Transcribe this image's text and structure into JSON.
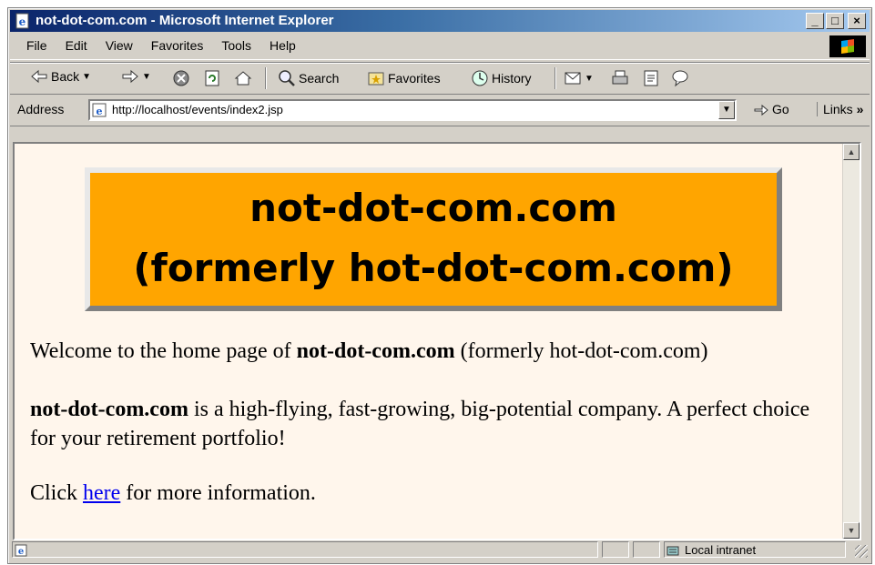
{
  "window": {
    "title": "not-dot-com.com - Microsoft Internet Explorer",
    "controls": {
      "minimize": "_",
      "maximize": "□",
      "close": "×"
    }
  },
  "menu": {
    "items": [
      "File",
      "Edit",
      "View",
      "Favorites",
      "Tools",
      "Help"
    ]
  },
  "toolbar": {
    "back": "Back",
    "search": "Search",
    "favorites": "Favorites",
    "history": "History"
  },
  "address": {
    "label": "Address",
    "url": "http://localhost/events/index2.jsp",
    "go": "Go",
    "links": "Links"
  },
  "page": {
    "banner_line1": "not-dot-com.com",
    "banner_line2": "(formerly hot-dot-com.com)",
    "p1_pre": "Welcome to the home page of ",
    "p1_bold": "not-dot-com.com",
    "p1_post": " (formerly hot-dot-com.com)",
    "p2_bold": "not-dot-com.com",
    "p2_post": " is a high-flying, fast-growing, big-potential company. A perfect choice for your retirement portfolio!",
    "p3_pre": "Click ",
    "p3_link": "here",
    "p3_post": " for more information."
  },
  "status": {
    "zone": "Local intranet"
  },
  "colors": {
    "banner_bg": "#ffa500",
    "page_bg": "#fff6ec",
    "link": "#0000ee",
    "title_gradient_start": "#0a246a"
  },
  "icons": {
    "title": "ie-page-icon",
    "back": "back-arrow-icon",
    "forward": "forward-arrow-icon",
    "stop": "stop-icon",
    "refresh": "refresh-icon",
    "home": "home-icon",
    "search": "search-icon",
    "favorites": "favorites-icon",
    "history": "history-icon",
    "mail": "mail-icon",
    "print": "print-icon",
    "edit": "edit-icon",
    "discuss": "discuss-icon"
  }
}
